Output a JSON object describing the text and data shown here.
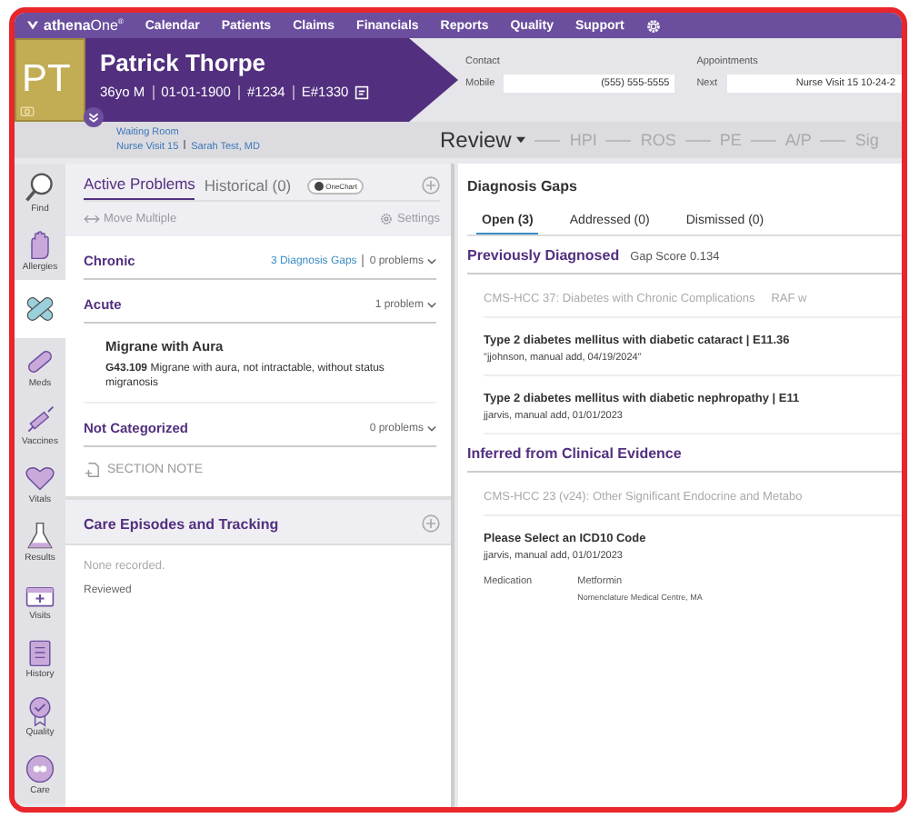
{
  "nav": {
    "logo": "**athena**One$^{®}$",
    "items": [
      "Calendar",
      "Patients",
      "Claims",
      "Financials",
      "Reports",
      "Quality",
      "Support"
    ]
  },
  "patient": {
    "initials": "PT",
    "name": "Patrick Thorpe",
    "details": [
      "36yo M",
      "01-01-1900",
      "#1234",
      "E#1330"
    ],
    "location": "Waiting Room",
    "visit": "Nurse Visit 15",
    "provider": "Sarah Test, MD"
  },
  "contact": {
    "label": "Contact",
    "field_label": "Mobile",
    "value": "(555) 555-5555"
  },
  "appointments": {
    "label": "Appointments",
    "field_label": "Next",
    "value": "Nurse Visit 15 10-24-2"
  },
  "workflow": [
    {
      "label": "Review",
      "selected": true
    },
    {
      "label": "HPI",
      "selected": false
    },
    {
      "label": "ROS",
      "selected": false
    },
    {
      "label": "PE",
      "selected": false
    },
    {
      "label": "A/P",
      "selected": false
    },
    {
      "label": "Sig",
      "selected": false
    }
  ],
  "sidebar": [
    {
      "label": "Find",
      "selected": false
    },
    {
      "label": "Allergies",
      "selected": false
    },
    {
      "selected": true
    },
    {
      "label": "Meds",
      "selected": false
    },
    {
      "label": "Vaccines",
      "selected": false
    },
    {
      "label": "Vitals",
      "selected": false
    },
    {
      "label": "Results",
      "selected": false
    },
    {
      "label": "Visits",
      "selected": false
    },
    {
      "label": "History",
      "selected": false
    },
    {
      "label": "Quality",
      "selected": false
    },
    {
      "label": "Care",
      "selected": false
    }
  ],
  "problems": {
    "tabs": [
      {
        "label": "Active Problems",
        "selected": true
      },
      {
        "label": "Historical (0)",
        "selected": false
      }
    ],
    "toggle": "OneChart",
    "tools": [
      {
        "label": "Move Multiple",
        "disabled": true
      },
      {
        "label": "Settings",
        "disabled": true
      }
    ],
    "sections": [
      {
        "title": "Chronic",
        "link": "3 Diagnosis Gaps",
        "count": "0 problems"
      },
      {
        "title": "Acute",
        "count": "1 problem",
        "problems": [
          {
            "name": "Migrane with Aura",
            "code": "G43.109",
            "description": "Migrane with aura, not intractable, without status migranosis"
          }
        ]
      },
      {
        "title": "Not Categorized",
        "count": "0 problems"
      }
    ],
    "section_note": "SECTION NOTE"
  },
  "care": {
    "title": "Care Episodes and Tracking",
    "empty": "None recorded.",
    "status": "Reviewed"
  },
  "gaps": {
    "title": "Diagnosis Gaps",
    "tabs": [
      {
        "label": "Open (3)",
        "selected": true
      },
      {
        "label": "Addressed (0)",
        "selected": false
      },
      {
        "label": "Dismissed (0)",
        "selected": false
      }
    ],
    "groups": [
      {
        "title": "Previously Diagnosed",
        "score": "Gap Score 0.134",
        "category": "CMS-HCC 37: Diabetes with Chronic Complications",
        "category_extra": "RAF w",
        "entries": [
          {
            "title": "Type 2 diabetes mellitus with diabetic cataract | E11.36",
            "note": "\"jjohnson, manual add, 04/19/2024\""
          },
          {
            "title": "Type 2 diabetes mellitus with diabetic nephropathy | E11",
            "note": "jjarvis, manual add, 01/01/2023"
          }
        ]
      },
      {
        "title": "Inferred from Clinical Evidence",
        "category": "CMS-HCC 23 (v24): Other Significant Endocrine and Metabo",
        "entries": [
          {
            "title": "Please Select an ICD10 Code",
            "note": "jjarvis, manual add, 01/01/2023",
            "evidence": {
              "label": "Medication",
              "value": "Metformin",
              "source": "Nomenclature Medical Centre, MA"
            }
          }
        ]
      }
    ]
  }
}
